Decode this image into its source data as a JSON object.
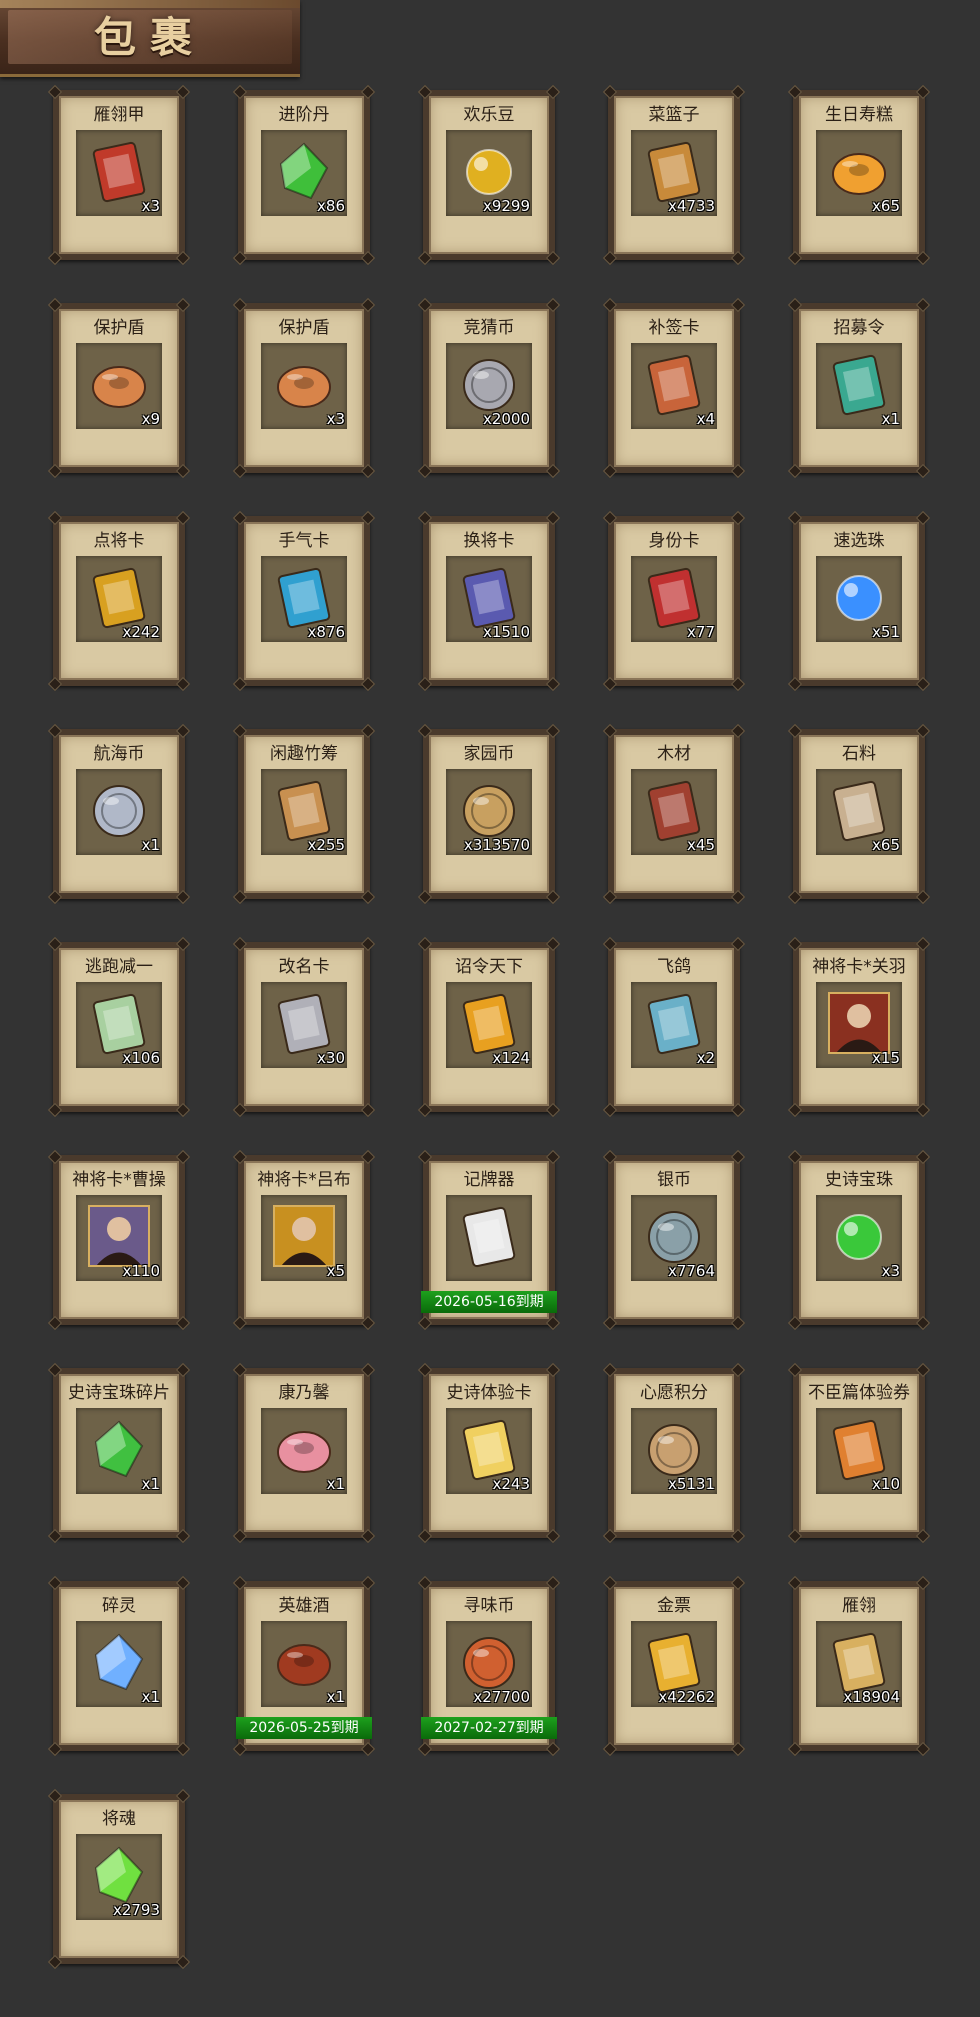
{
  "header": {
    "title": "包裹"
  },
  "items": [
    {
      "name": "雁翎甲",
      "qty": "x3",
      "icon": "armor-icon",
      "color": "#c03a2a"
    },
    {
      "name": "进阶丹",
      "qty": "x86",
      "icon": "pill-icon",
      "color": "#3fbf3a"
    },
    {
      "name": "欢乐豆",
      "qty": "x9299",
      "icon": "beans-icon",
      "color": "#e0b020"
    },
    {
      "name": "菜篮子",
      "qty": "x4733",
      "icon": "basket-icon",
      "color": "#c88a3a"
    },
    {
      "name": "生日寿糕",
      "qty": "x65",
      "icon": "cake-icon",
      "color": "#f0a030"
    },
    {
      "name": "保护盾",
      "qty": "x9",
      "icon": "shield-icon",
      "color": "#d8844a"
    },
    {
      "name": "保护盾",
      "qty": "x3",
      "icon": "shield-icon",
      "color": "#d8844a"
    },
    {
      "name": "竞猜币",
      "qty": "x2000",
      "icon": "silver-coin-icon",
      "color": "#a8a8b0"
    },
    {
      "name": "补签卡",
      "qty": "x4",
      "icon": "tag-icon",
      "color": "#c8643a"
    },
    {
      "name": "招募令",
      "qty": "x1",
      "icon": "recruit-token-icon",
      "color": "#3aa890"
    },
    {
      "name": "点将卡",
      "qty": "x242",
      "icon": "general-card-icon",
      "color": "#d8a020"
    },
    {
      "name": "手气卡",
      "qty": "x876",
      "icon": "luck-card-icon",
      "color": "#30a0d0"
    },
    {
      "name": "换将卡",
      "qty": "x1510",
      "icon": "swap-card-icon",
      "color": "#5a5ab0"
    },
    {
      "name": "身份卡",
      "qty": "x77",
      "icon": "mask-card-icon",
      "color": "#c03030"
    },
    {
      "name": "速选珠",
      "qty": "x51",
      "icon": "orb-icon",
      "color": "#3a90ff"
    },
    {
      "name": "航海币",
      "qty": "x1",
      "icon": "sail-coin-icon",
      "color": "#b0b8c8"
    },
    {
      "name": "闲趣竹筹",
      "qty": "x255",
      "icon": "bamboo-token-icon",
      "color": "#c89050"
    },
    {
      "name": "家园币",
      "qty": "x313570",
      "icon": "home-coin-icon",
      "color": "#c8a060"
    },
    {
      "name": "木材",
      "qty": "x45",
      "icon": "wood-icon",
      "color": "#a04030"
    },
    {
      "name": "石料",
      "qty": "x65",
      "icon": "stone-icon",
      "color": "#c8b090"
    },
    {
      "name": "逃跑减一",
      "qty": "x106",
      "icon": "jade-tag-icon",
      "color": "#a8d0a0"
    },
    {
      "name": "改名卡",
      "qty": "x30",
      "icon": "rename-card-icon",
      "color": "#b0b0b8"
    },
    {
      "name": "诏令天下",
      "qty": "x124",
      "icon": "scroll-icon",
      "color": "#e8a020"
    },
    {
      "name": "飞鸽",
      "qty": "x2",
      "icon": "pigeon-icon",
      "color": "#6ab0c8"
    },
    {
      "name": "神将卡*关羽",
      "qty": "x15",
      "icon": "hero-portrait-icon",
      "color": "#8a3020"
    },
    {
      "name": "神将卡*曹操",
      "qty": "x110",
      "icon": "hero-portrait-icon",
      "color": "#6a5a8a"
    },
    {
      "name": "神将卡*吕布",
      "qty": "x5",
      "icon": "hero-portrait-icon",
      "color": "#c89020"
    },
    {
      "name": "记牌器",
      "qty": "",
      "icon": "cards-icon",
      "color": "#e8e8e8",
      "expiry": "2026-05-16到期"
    },
    {
      "name": "银币",
      "qty": "x7764",
      "icon": "silver-coins-icon",
      "color": "#8aa0a8"
    },
    {
      "name": "史诗宝珠",
      "qty": "x3",
      "icon": "orb-icon",
      "color": "#3ac83a"
    },
    {
      "name": "史诗宝珠碎片",
      "qty": "x1",
      "icon": "shard-icon",
      "color": "#40c040"
    },
    {
      "name": "康乃馨",
      "qty": "x1",
      "icon": "flower-icon",
      "color": "#e890a0"
    },
    {
      "name": "史诗体验卡",
      "qty": "x243",
      "icon": "gold-card-icon",
      "color": "#f0d060"
    },
    {
      "name": "心愿积分",
      "qty": "x5131",
      "icon": "heart-coin-icon",
      "color": "#c8a070"
    },
    {
      "name": "不臣篇体验券",
      "qty": "x10",
      "icon": "ticket-icon",
      "color": "#e08030"
    },
    {
      "name": "碎灵",
      "qty": "x1",
      "icon": "crystal-icon",
      "color": "#70b0ff"
    },
    {
      "name": "英雄酒",
      "qty": "x1",
      "icon": "wine-jar-icon",
      "color": "#a03a20",
      "expiry": "2026-05-25到期"
    },
    {
      "name": "寻味币",
      "qty": "x27700",
      "icon": "taste-coin-icon",
      "color": "#d06030",
      "expiry": "2027-02-27到期"
    },
    {
      "name": "金票",
      "qty": "x42262",
      "icon": "gold-ticket-icon",
      "color": "#e8b030"
    },
    {
      "name": "雁翎",
      "qty": "x18904",
      "icon": "feather-icon",
      "color": "#d8b060"
    },
    {
      "name": "将魂",
      "qty": "x2793",
      "icon": "soul-gem-icon",
      "color": "#70e040"
    }
  ]
}
